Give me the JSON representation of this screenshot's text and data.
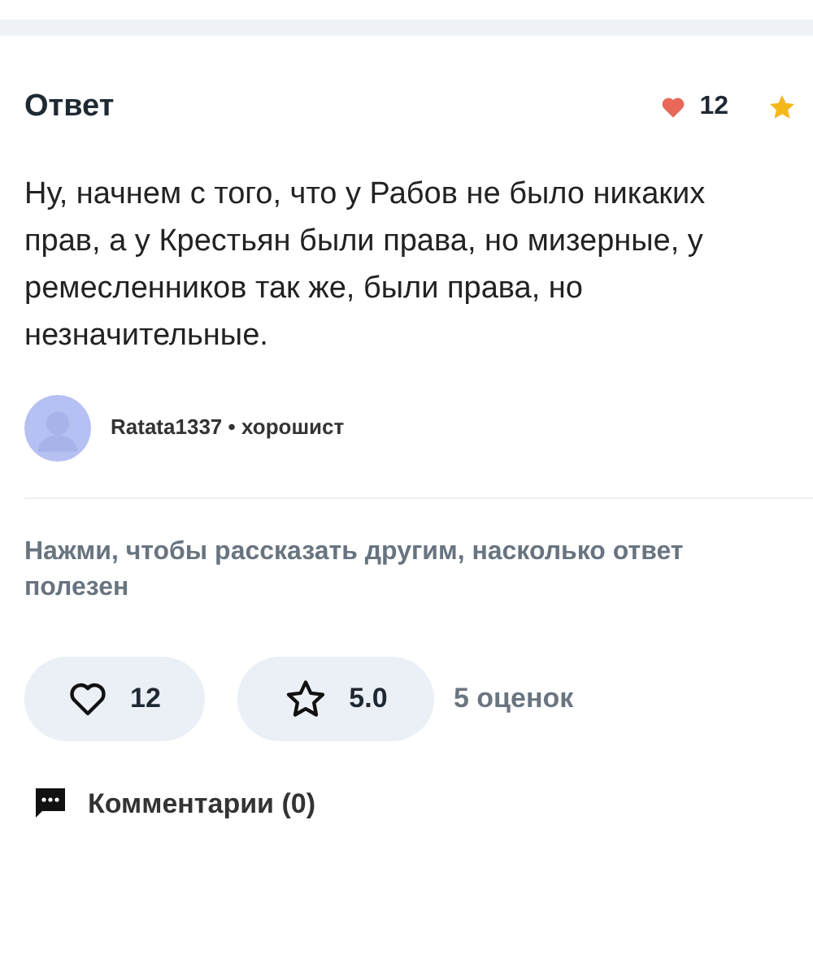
{
  "answer": {
    "title": "Ответ",
    "likes": "12",
    "text": "Ну, начнем с того, что у Рабов не было никаких прав, а у Крестьян были права, но мизерные, у ремесленников так же, были права, но незначительные.",
    "author": {
      "name": "Ratata1337",
      "separator": "•",
      "rank": "хорошист"
    }
  },
  "feedback": {
    "prompt_lines": [
      "Нажми, чтобы рассказать другим, насколько ответ",
      "полезен"
    ],
    "like_button": "12",
    "rating_button": "5.0",
    "ratings_count": "5 оценок"
  },
  "comments": "Комментарии (0)"
}
